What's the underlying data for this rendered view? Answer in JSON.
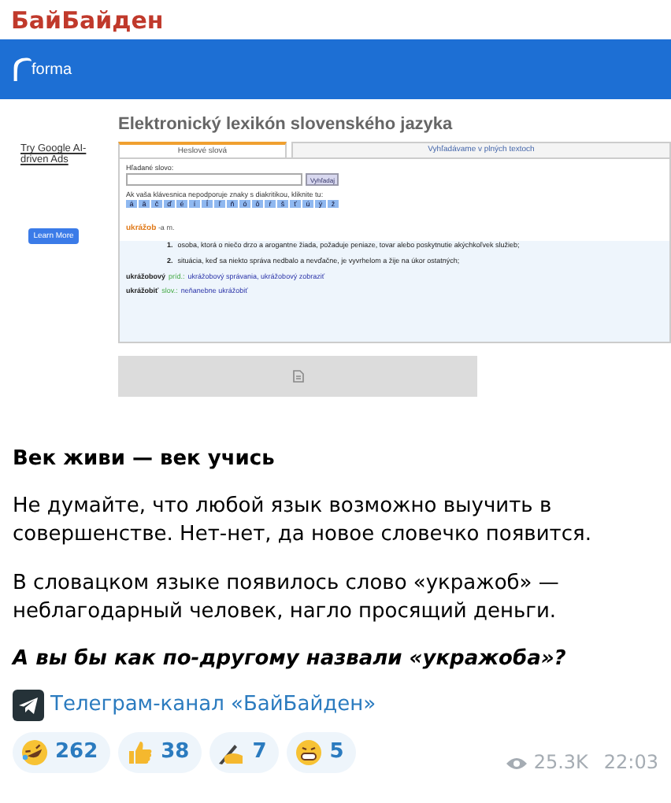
{
  "channel_title": "БайБайден",
  "shot": {
    "logo": "forma",
    "site_title": "Elektronický lexikón slovenského jazyka",
    "ad": {
      "headline": "Try Google AI-driven Ads",
      "button": "Learn More"
    },
    "tabs": [
      {
        "label": "Heslové slová",
        "selected": true
      },
      {
        "label": "Vyhľadávame v plných textoch",
        "selected": false
      }
    ],
    "search_label": "Hľadané slovo:",
    "search_button": "Vyhľadaj",
    "diacritics_hint": "Ak vaša klávesnica nepodporuje znaky s diakritikou, kliknite tu:",
    "letters": [
      "á",
      "ä",
      "č",
      "ď",
      "é",
      "í",
      "ĺ",
      "ľ",
      "ň",
      "ó",
      "ô",
      "ŕ",
      "š",
      "ť",
      "ú",
      "ý",
      "ž"
    ],
    "entry": {
      "word": "ukrážob",
      "grammar": "-a m.",
      "senses": [
        {
          "number": "1.",
          "text": "osoba, ktorá o niečo drzo a arogantne žiada, požaduje peniaze, tovar alebo poskytnutie akýchkoľvek služieb;"
        },
        {
          "number": "2.",
          "text": "situácia, keď sa niekto správa nedbalo a nevďačne, je vyvrhelom a žije na úkor ostatných;"
        }
      ]
    },
    "derived": [
      {
        "word": "ukrážobový",
        "pos": "príd.:",
        "examples": "ukrážobový správania, ukrážobový zobraziť"
      },
      {
        "word": "ukrážobiť",
        "pos": "slov.:",
        "examples": "neňanebne ukrážobiť"
      }
    ]
  },
  "post": {
    "heading": "Век живи — век учись",
    "paragraphs": [
      "Не думайте, что любой язык возможно выучить в совершенстве. Нет-нет, да новое словечко появится.",
      "В словацком языке появилось слово «укражоб» — неблагодарный человек, нагло просящий деньги."
    ],
    "question": "А вы бы как по-другому назвали «укражоба»?",
    "link": "Телеграм-канал «БайБайден»"
  },
  "reactions": [
    {
      "kind": "rofl",
      "count": "262"
    },
    {
      "kind": "thumbs",
      "count": "38"
    },
    {
      "kind": "writing",
      "count": "7"
    },
    {
      "kind": "grin",
      "count": "5"
    }
  ],
  "views": "25.3K",
  "time": "22:03"
}
